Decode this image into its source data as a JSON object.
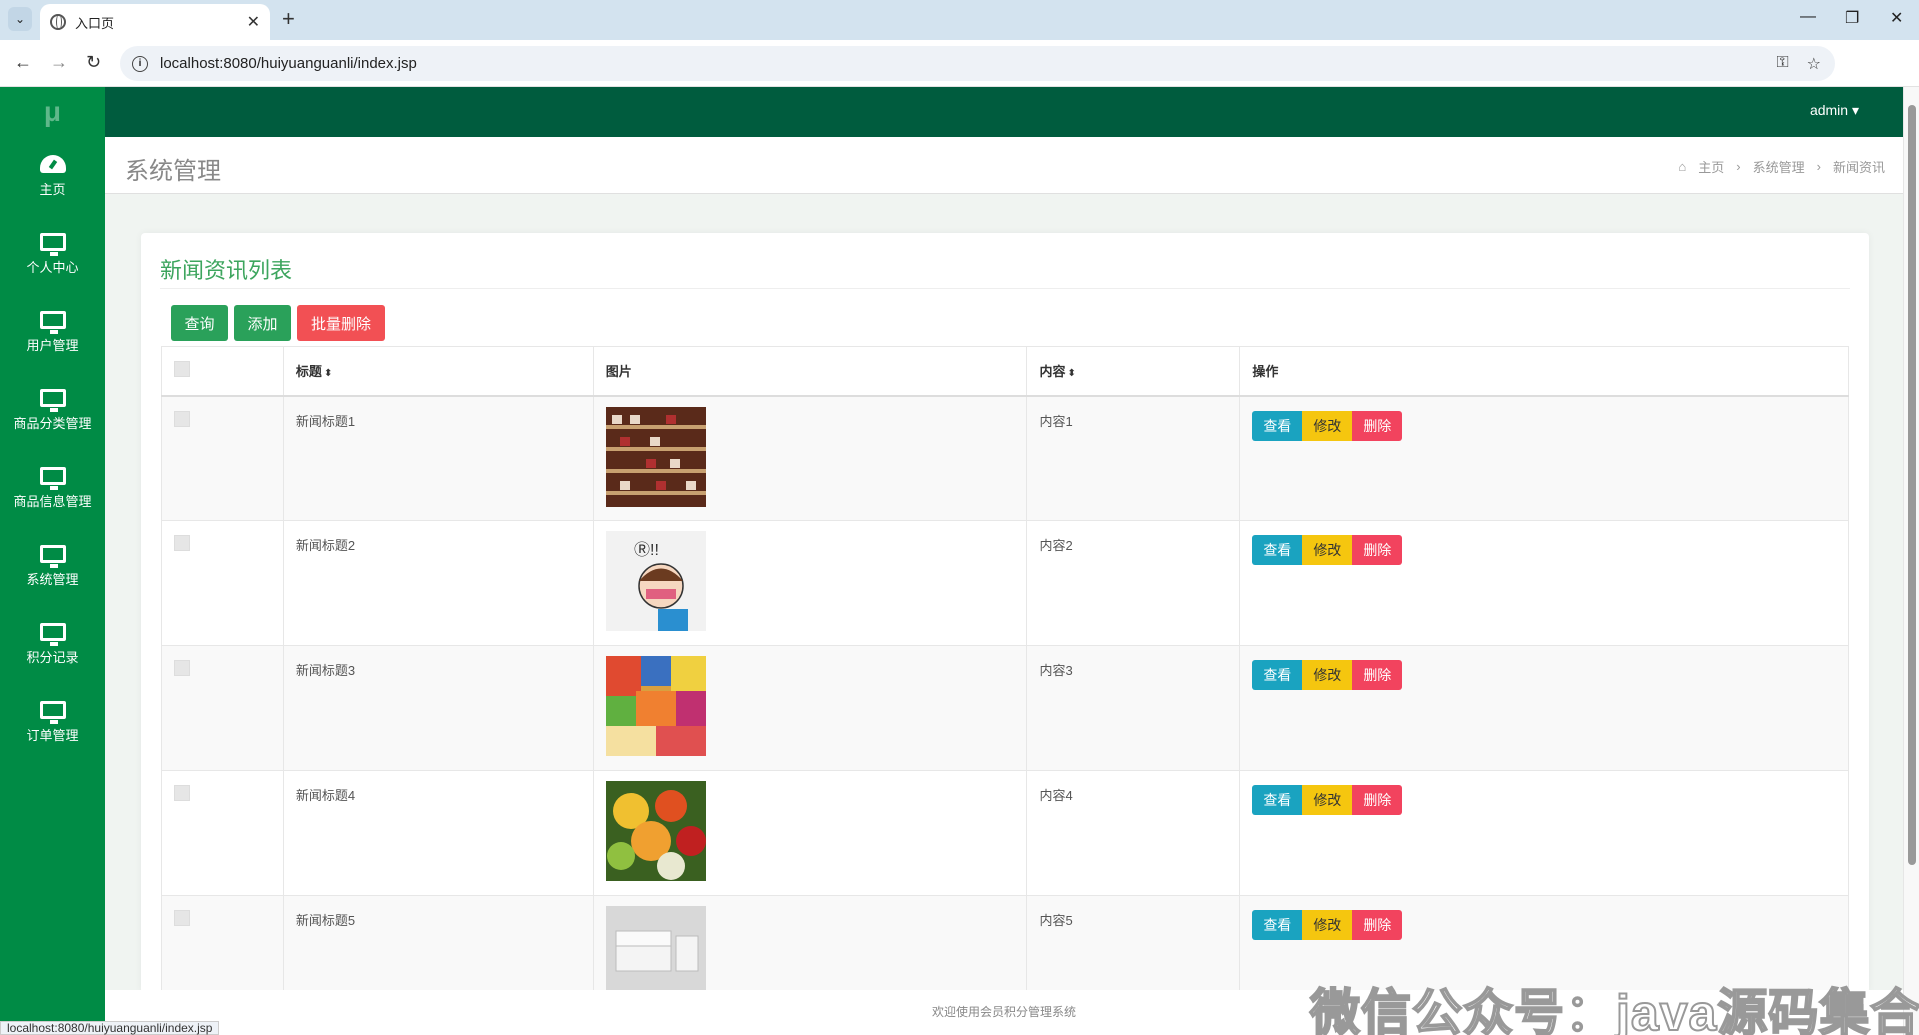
{
  "browser": {
    "tab_title": "入口页",
    "url": "localhost:8080/huiyuanguanli/index.jsp",
    "status_url": "localhost:8080/huiyuanguanli/index.jsp"
  },
  "app": {
    "logo": "μ",
    "user": "admin ▾"
  },
  "sidebar": {
    "items": [
      {
        "label": "主页",
        "icon": "dashboard-icon"
      },
      {
        "label": "个人中心",
        "icon": "monitor-icon"
      },
      {
        "label": "用户管理",
        "icon": "monitor-icon"
      },
      {
        "label": "商品分类管理",
        "icon": "monitor-icon"
      },
      {
        "label": "商品信息管理",
        "icon": "monitor-icon"
      },
      {
        "label": "系统管理",
        "icon": "monitor-icon"
      },
      {
        "label": "积分记录",
        "icon": "monitor-icon"
      },
      {
        "label": "订单管理",
        "icon": "monitor-icon"
      }
    ]
  },
  "header": {
    "page_title": "系统管理",
    "breadcrumb": [
      "主页",
      "系统管理",
      "新闻资讯"
    ]
  },
  "card": {
    "title": "新闻资讯列表",
    "buttons": {
      "search": "查询",
      "add": "添加",
      "batch_delete": "批量删除"
    }
  },
  "table": {
    "columns": [
      "标题",
      "图片",
      "内容",
      "操作"
    ],
    "sort_glyph": "⬍",
    "actions": {
      "view": "查看",
      "edit": "修改",
      "delete": "删除"
    },
    "rows": [
      {
        "title": "新闻标题1",
        "content": "内容1",
        "image": "shoe-shelf"
      },
      {
        "title": "新闻标题2",
        "content": "内容2",
        "image": "cartoon-girl"
      },
      {
        "title": "新闻标题3",
        "content": "内容3",
        "image": "snacks"
      },
      {
        "title": "新闻标题4",
        "content": "内容4",
        "image": "fruits"
      },
      {
        "title": "新闻标题5",
        "content": "内容5",
        "image": "sofa"
      }
    ]
  },
  "footer": {
    "text": "欢迎使用会员积分管理系统"
  },
  "watermark": "微信公众号：java源码集合",
  "colors": {
    "sidebar": "#008b45",
    "topbar": "#005c3e",
    "accent": "#3da55e",
    "view": "#1aa3c0",
    "edit": "#f5c60f",
    "delete": "#f2435e"
  }
}
